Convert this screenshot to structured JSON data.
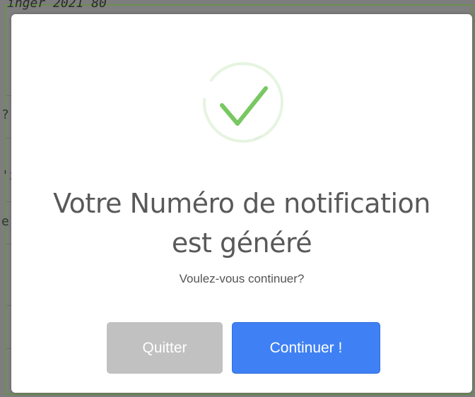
{
  "background": {
    "top_text": "ınger 2021 80",
    "glyphs": [
      "?",
      "'ı",
      "e"
    ]
  },
  "modal": {
    "icon": "success-checkmark-icon",
    "title_line1": "Votre Numéro de notification",
    "title_line2": "est généré",
    "subtitle": "Voulez-vous continuer?",
    "cancel_label": "Quitter",
    "confirm_label": "Continuer !"
  },
  "colors": {
    "success_green": "#78c862",
    "success_ring": "#e6f4e0",
    "confirm_button": "#3f81f5",
    "cancel_button": "#c1c1c1",
    "title_text": "#595959"
  }
}
